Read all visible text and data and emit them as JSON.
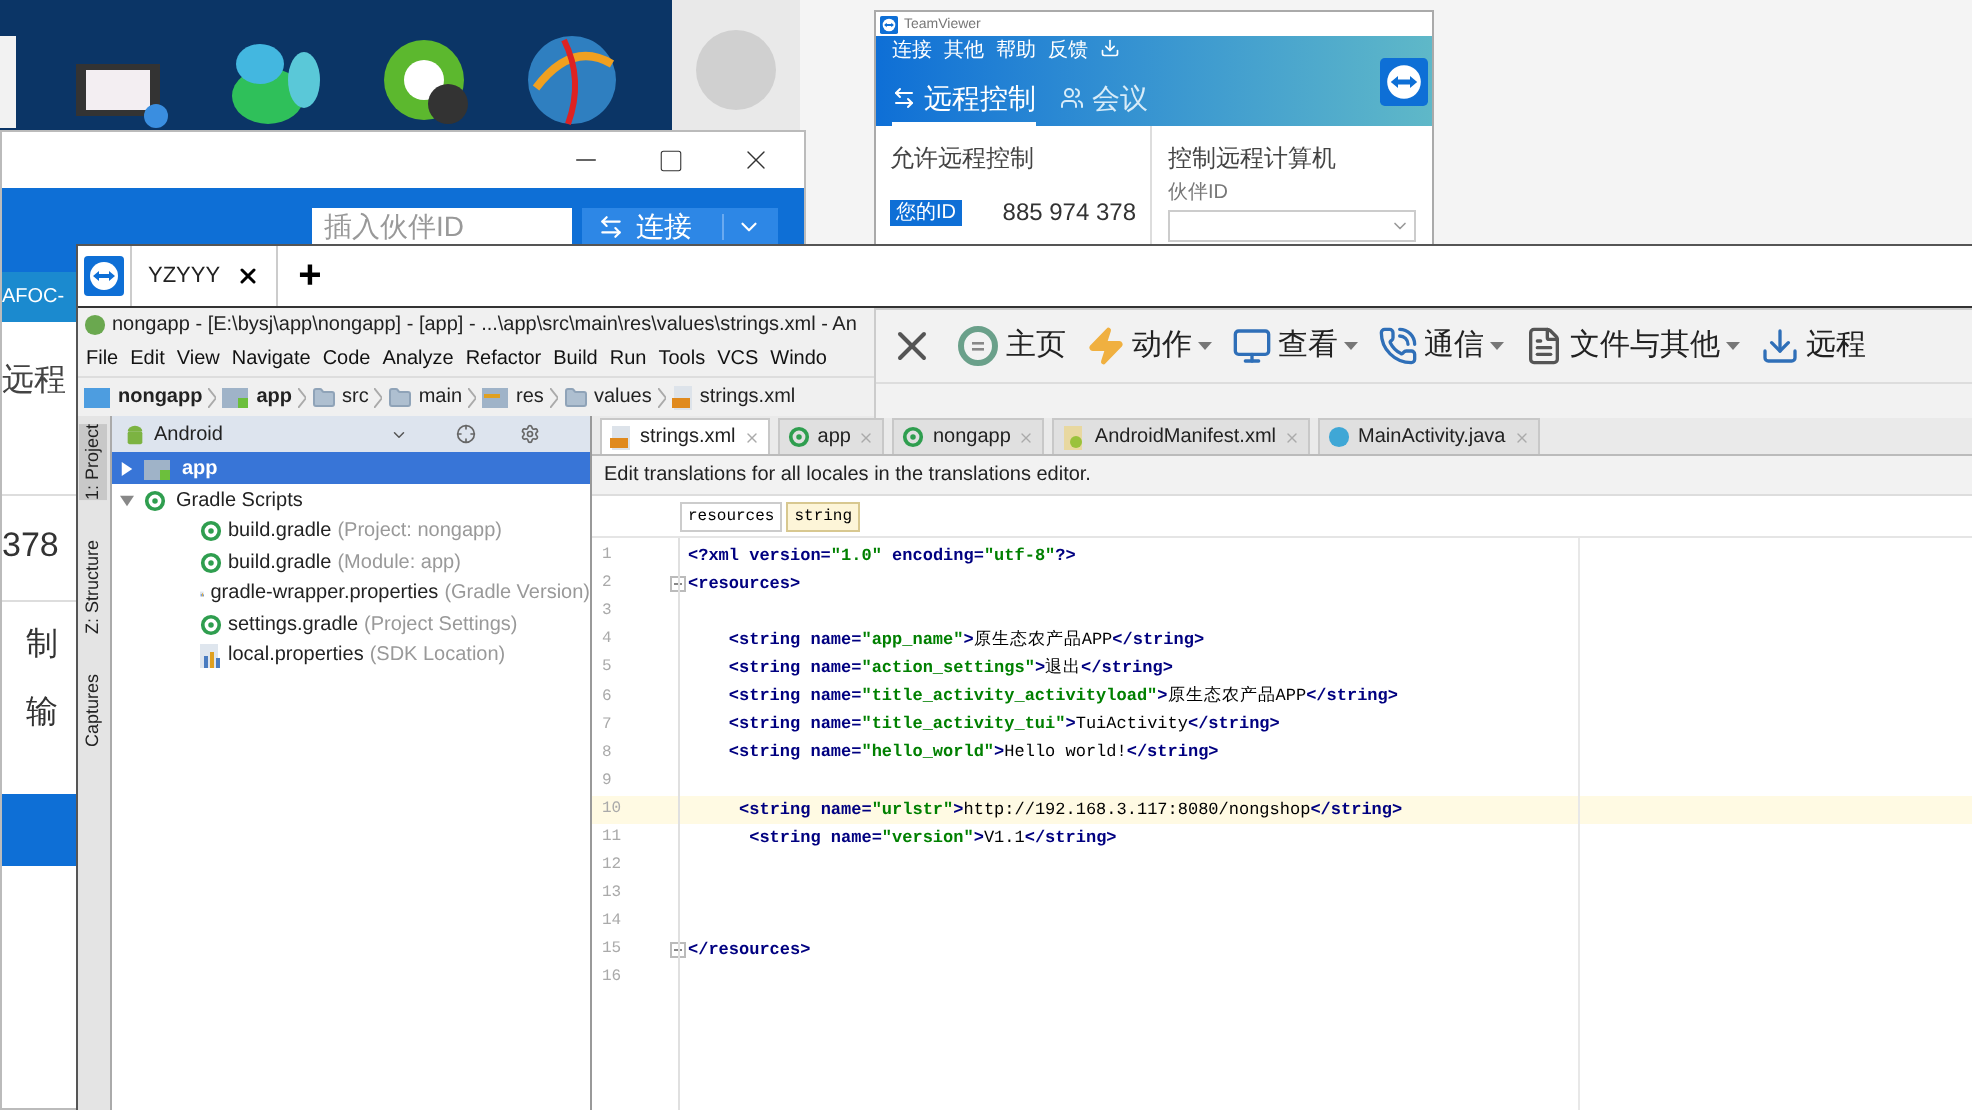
{
  "back_window": {
    "partner_placeholder": "插入伙伴ID",
    "connect_button": "连接",
    "computer_name": "AFOC-",
    "heading": "远程",
    "id_tail": "378",
    "options": [
      "制",
      "输"
    ]
  },
  "teamviewer_window": {
    "title": "TeamViewer",
    "menu": [
      "连接",
      "其他",
      "帮助",
      "反馈"
    ],
    "tabs": [
      {
        "label": "远程控制",
        "selected": true,
        "kind": "remote"
      },
      {
        "label": "会议",
        "selected": false,
        "kind": "meeting"
      }
    ],
    "allow_heading": "允许远程控制",
    "id_label": "您的ID",
    "id_value": "885 974 378",
    "control_heading": "控制远程计算机",
    "partner_label": "伙伴ID"
  },
  "session": {
    "tabs": [
      {
        "label": "YZYYY",
        "selected": true
      }
    ],
    "new_tab": "+",
    "toolbar": [
      {
        "label": "主页",
        "kind": "home",
        "dropdown": false
      },
      {
        "label": "动作",
        "kind": "actions",
        "dropdown": true
      },
      {
        "label": "查看",
        "kind": "view",
        "dropdown": true
      },
      {
        "label": "通信",
        "kind": "communicate",
        "dropdown": true
      },
      {
        "label": "文件与其他",
        "kind": "files",
        "dropdown": true
      },
      {
        "label": "远程",
        "kind": "download",
        "dropdown": false
      }
    ]
  },
  "ide": {
    "title": "nongapp - [E:\\bysj\\app\\nongapp] - [app] - ...\\app\\src\\main\\res\\values\\strings.xml - An",
    "menu": [
      "File",
      "Edit",
      "View",
      "Navigate",
      "Code",
      "Analyze",
      "Refactor",
      "Build",
      "Run",
      "Tools",
      "VCS",
      "Windo"
    ],
    "breadcrumb": [
      {
        "label": "nongapp",
        "kind": "project"
      },
      {
        "label": "app",
        "kind": "module"
      },
      {
        "label": "src",
        "kind": "folder"
      },
      {
        "label": "main",
        "kind": "folder"
      },
      {
        "label": "res",
        "kind": "res"
      },
      {
        "label": "values",
        "kind": "folder"
      },
      {
        "label": "strings.xml",
        "kind": "xml"
      }
    ],
    "side_tabs": [
      {
        "label": "1: Project",
        "selected": true
      },
      {
        "label": "Z: Structure",
        "selected": false
      },
      {
        "label": "Captures",
        "selected": false
      }
    ],
    "project_view": "Android",
    "tree": [
      {
        "label": "app",
        "kind": "module",
        "selected": true,
        "expanded": false
      },
      {
        "label": "Gradle Scripts",
        "kind": "gradle",
        "selected": false,
        "expanded": true,
        "children": [
          {
            "label": "build.gradle",
            "note": "(Project: nongapp)",
            "kind": "gradle"
          },
          {
            "label": "build.gradle",
            "note": "(Module: app)",
            "kind": "gradle"
          },
          {
            "label": "gradle-wrapper.properties",
            "note": "(Gradle Version)",
            "kind": "properties"
          },
          {
            "label": "settings.gradle",
            "note": "(Project Settings)",
            "kind": "gradle"
          },
          {
            "label": "local.properties",
            "note": "(SDK Location)",
            "kind": "properties"
          }
        ]
      }
    ],
    "editor_tabs": [
      {
        "label": "strings.xml",
        "kind": "xml",
        "selected": true
      },
      {
        "label": "app",
        "kind": "gradle",
        "selected": false
      },
      {
        "label": "nongapp",
        "kind": "gradle",
        "selected": false
      },
      {
        "label": "AndroidManifest.xml",
        "kind": "manifest",
        "selected": false
      },
      {
        "label": "MainActivity.java",
        "kind": "java",
        "selected": false
      }
    ],
    "banner": "Edit translations for all locales in the translations editor.",
    "banner_buttons": [
      {
        "label": "resources",
        "selected": false
      },
      {
        "label": "string",
        "selected": true
      }
    ],
    "lines": [
      {
        "number": "1",
        "code": "<?xml version=\"1.0\" encoding=\"utf-8\"?>",
        "current": false,
        "fold": false
      },
      {
        "number": "2",
        "code": "<resources>",
        "current": false,
        "fold": true
      },
      {
        "number": "3",
        "current": false,
        "fold": false
      },
      {
        "number": "4",
        "code": "    <string name=\"app_name\">原生态农产品APP</string>",
        "current": false,
        "fold": false
      },
      {
        "number": "5",
        "code": "    <string name=\"action_settings\">退出</string>",
        "current": false,
        "fold": false
      },
      {
        "number": "6",
        "code": "    <string name=\"title_activity_activityload\">原生态农产品APP</string>",
        "current": false,
        "fold": false
      },
      {
        "number": "7",
        "code": "    <string name=\"title_activity_tui\">TuiActivity</string>",
        "current": false,
        "fold": false
      },
      {
        "number": "8",
        "code": "    <string name=\"hello_world\">Hello world!</string>",
        "current": false,
        "fold": false
      },
      {
        "number": "9",
        "current": false,
        "fold": false
      },
      {
        "number": "10",
        "code": "     <string name=\"urlstr\">http://192.168.3.117:8080/nongshop</string>",
        "current": true,
        "fold": false
      },
      {
        "number": "11",
        "code": "      <string name=\"version\">V1.1</string>",
        "current": false,
        "fold": false
      },
      {
        "number": "12",
        "current": false,
        "fold": false
      },
      {
        "number": "13",
        "current": false,
        "fold": false
      },
      {
        "number": "14",
        "current": false,
        "fold": false
      },
      {
        "number": "15",
        "code": "</resources>",
        "current": false,
        "fold": true
      },
      {
        "number": "16",
        "current": false,
        "fold": false
      }
    ]
  }
}
